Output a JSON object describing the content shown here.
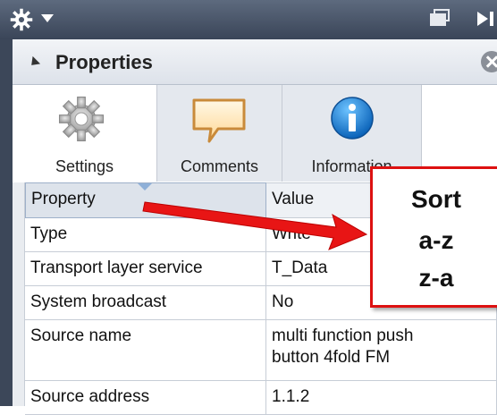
{
  "toolbar": {
    "menu_icon": "gear-icon",
    "dropdown_icon": "caret-down-icon"
  },
  "panel": {
    "title": "Properties",
    "close_icon": "close-circle-icon"
  },
  "tabs": [
    {
      "label": "Settings",
      "icon": "gear-icon",
      "selected": true
    },
    {
      "label": "Comments",
      "icon": "speech-bubble-icon",
      "selected": false
    },
    {
      "label": "Information",
      "icon": "info-icon",
      "selected": false
    }
  ],
  "table": {
    "columns": [
      "Property",
      "Value"
    ],
    "rows": [
      {
        "property": "Type",
        "value": "Write"
      },
      {
        "property": "Transport layer service",
        "value": "T_Data"
      },
      {
        "property": "System broadcast",
        "value": "No"
      },
      {
        "property": "Source name",
        "value": "multi function push button 4fold FM"
      },
      {
        "property": "Source address",
        "value": "1.1.2"
      }
    ]
  },
  "callout": {
    "title": "Sort",
    "options": [
      "a-z",
      "z-a"
    ],
    "color": "#dd1111"
  }
}
